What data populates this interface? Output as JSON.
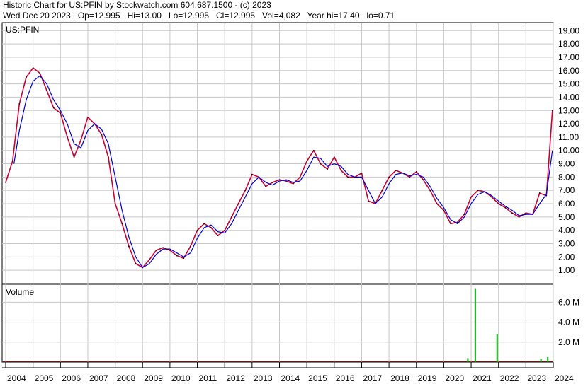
{
  "header": {
    "line1": "Historic Chart for US:PFIN by Stockwatch.com 604.687.1500 - (c) 2023",
    "line2": "Wed Dec 20 2023   Op=12.995   Hi=13.00   Lo=12.995   Cl=12.995   Vol=4,082   Year hi=17.40   lo=0.71"
  },
  "chart_data": [
    {
      "type": "line",
      "title": "US:PFIN",
      "x_ticks": [
        "2004",
        "2005",
        "2006",
        "2007",
        "2008",
        "2009",
        "2010",
        "2011",
        "2012",
        "2013",
        "2014",
        "2015",
        "2016",
        "2017",
        "2018",
        "2019",
        "2020",
        "2021",
        "2022",
        "2023",
        "2024"
      ],
      "y_ticks": [
        "19.00",
        "18.00",
        "17.00",
        "16.00",
        "15.00",
        "14.00",
        "13.00",
        "12.00",
        "11.00",
        "10.00",
        "9.00",
        "8.00",
        "7.00",
        "6.00",
        "5.00",
        "4.00",
        "3.00",
        "2.00",
        "1.00"
      ],
      "ylim": [
        0,
        19.6
      ],
      "grid": true,
      "series": [
        {
          "role": "price",
          "color": "#cc0033",
          "x": [
            2004.0,
            2004.25,
            2004.5,
            2004.75,
            2005.0,
            2005.25,
            2005.5,
            2005.75,
            2006.0,
            2006.25,
            2006.5,
            2006.75,
            2007.0,
            2007.25,
            2007.5,
            2007.75,
            2008.0,
            2008.25,
            2008.5,
            2008.75,
            2009.0,
            2009.25,
            2009.5,
            2009.75,
            2010.0,
            2010.25,
            2010.5,
            2010.75,
            2011.0,
            2011.25,
            2011.5,
            2011.75,
            2012.0,
            2012.25,
            2012.5,
            2012.75,
            2013.0,
            2013.25,
            2013.5,
            2013.75,
            2014.0,
            2014.25,
            2014.5,
            2014.75,
            2015.0,
            2015.25,
            2015.5,
            2015.75,
            2016.0,
            2016.25,
            2016.5,
            2016.75,
            2017.0,
            2017.25,
            2017.5,
            2017.75,
            2018.0,
            2018.25,
            2018.5,
            2018.75,
            2019.0,
            2019.25,
            2019.5,
            2019.75,
            2020.0,
            2020.25,
            2020.5,
            2020.75,
            2021.0,
            2021.25,
            2021.5,
            2021.75,
            2022.0,
            2022.25,
            2022.5,
            2022.75,
            2023.0,
            2023.25,
            2023.5,
            2023.75,
            2023.97
          ],
          "values": [
            7.6,
            9.2,
            13.5,
            15.5,
            16.2,
            15.8,
            14.5,
            13.2,
            12.8,
            11.0,
            9.5,
            10.8,
            12.5,
            12.0,
            11.2,
            9.5,
            6.0,
            4.5,
            2.8,
            1.5,
            1.2,
            1.8,
            2.5,
            2.7,
            2.5,
            2.1,
            1.9,
            2.8,
            4.0,
            4.5,
            4.2,
            3.6,
            4.0,
            5.0,
            6.0,
            7.0,
            8.2,
            8.0,
            7.3,
            7.6,
            7.8,
            7.7,
            7.5,
            8.0,
            9.2,
            10.0,
            9.0,
            8.6,
            9.5,
            8.5,
            8.0,
            8.0,
            8.3,
            6.2,
            6.0,
            7.0,
            8.0,
            8.5,
            8.3,
            8.0,
            8.4,
            7.8,
            7.0,
            6.0,
            5.5,
            4.5,
            4.6,
            5.2,
            6.5,
            7.0,
            6.9,
            6.5,
            6.0,
            5.7,
            5.3,
            5.0,
            5.3,
            5.2,
            6.8,
            6.6,
            12.995
          ]
        },
        {
          "role": "moving-average",
          "color": "#0000cc",
          "x": [
            2004.3,
            2004.5,
            2004.75,
            2005.0,
            2005.25,
            2005.5,
            2005.75,
            2006.0,
            2006.25,
            2006.5,
            2006.75,
            2007.0,
            2007.25,
            2007.5,
            2007.75,
            2008.0,
            2008.25,
            2008.5,
            2008.75,
            2009.0,
            2009.25,
            2009.5,
            2009.75,
            2010.0,
            2010.25,
            2010.5,
            2010.75,
            2011.0,
            2011.25,
            2011.5,
            2011.75,
            2012.0,
            2012.25,
            2012.5,
            2012.75,
            2013.0,
            2013.25,
            2013.5,
            2013.75,
            2014.0,
            2014.25,
            2014.5,
            2014.75,
            2015.0,
            2015.25,
            2015.5,
            2015.75,
            2016.0,
            2016.25,
            2016.5,
            2016.75,
            2017.0,
            2017.25,
            2017.5,
            2017.75,
            2018.0,
            2018.25,
            2018.5,
            2018.75,
            2019.0,
            2019.25,
            2019.5,
            2019.75,
            2020.0,
            2020.25,
            2020.5,
            2020.75,
            2021.0,
            2021.25,
            2021.5,
            2021.75,
            2022.0,
            2022.25,
            2022.5,
            2022.75,
            2023.0,
            2023.25,
            2023.5,
            2023.75,
            2023.97
          ],
          "values": [
            9.0,
            11.5,
            13.8,
            15.2,
            15.6,
            15.0,
            13.8,
            13.0,
            12.0,
            10.5,
            10.2,
            11.5,
            12.0,
            11.6,
            10.5,
            8.0,
            5.5,
            3.5,
            2.0,
            1.2,
            1.5,
            2.2,
            2.6,
            2.6,
            2.3,
            2.0,
            2.3,
            3.4,
            4.2,
            4.4,
            3.9,
            3.8,
            4.5,
            5.5,
            6.5,
            7.5,
            8.0,
            7.6,
            7.4,
            7.7,
            7.8,
            7.6,
            7.7,
            8.5,
            9.5,
            9.4,
            8.8,
            9.0,
            8.8,
            8.2,
            8.0,
            8.0,
            7.0,
            6.0,
            6.5,
            7.5,
            8.2,
            8.3,
            8.1,
            8.2,
            8.0,
            7.3,
            6.4,
            5.7,
            4.8,
            4.5,
            5.0,
            6.0,
            6.7,
            6.9,
            6.6,
            6.2,
            5.8,
            5.5,
            5.1,
            5.2,
            5.2,
            6.0,
            6.7,
            10.0
          ]
        }
      ]
    },
    {
      "type": "bar",
      "title": "Volume",
      "y_ticks": [
        "6.0 M",
        "4.0 M",
        "2.0 M"
      ],
      "ylim": [
        0,
        7.8
      ],
      "spikes": [
        {
          "x": 2020.88,
          "value": 0.4
        },
        {
          "x": 2021.15,
          "value": 7.4
        },
        {
          "x": 2021.95,
          "value": 2.8
        },
        {
          "x": 2023.55,
          "value": 0.3
        },
        {
          "x": 2023.8,
          "value": 0.5
        }
      ],
      "color": "#00aa00"
    }
  ]
}
